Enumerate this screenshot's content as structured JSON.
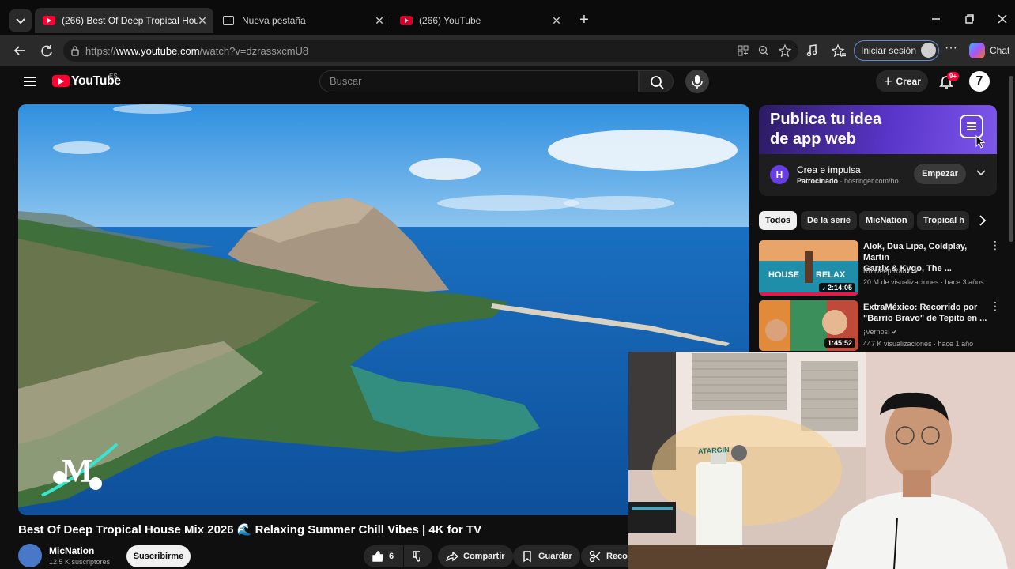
{
  "browser": {
    "tabs": [
      {
        "title": "(266) Best Of Deep Tropical House",
        "active": true
      },
      {
        "title": "Nueva pestaña",
        "active": false
      },
      {
        "title": "(266) YouTube",
        "active": false
      }
    ],
    "url_prefix": "https://",
    "url_host": "www.youtube.com",
    "url_path": "/watch?v=dzrassxcmU8",
    "signin_label": "Iniciar sesión",
    "copilot_label": "Chat"
  },
  "youtube": {
    "logo_text": "YouTube",
    "country_code": "ES",
    "search_placeholder": "Buscar",
    "create_label": "Crear",
    "notification_count": "9+",
    "avatar_letter": "7",
    "accent_color": "#ff0033"
  },
  "video": {
    "title": "Best Of Deep Tropical House Mix 2026 🌊 Relaxing Summer Chill Vibes | 4K for TV",
    "channel_name": "MicNation",
    "channel_subs": "12,5 K suscriptores",
    "subscribe_label": "Suscribirme",
    "like_count": "6",
    "share_label": "Compartir",
    "save_label": "Guardar",
    "clip_label": "Recor"
  },
  "ad": {
    "headline_line1": "Publica tu idea",
    "headline_line2": "de app web",
    "logo_letter": "H",
    "title": "Crea e impulsa",
    "sponsored_label": "Patrocinado",
    "domain": "· hostinger.com/ho...",
    "cta_label": "Empezar"
  },
  "chips": [
    "Todos",
    "De la serie",
    "MicNation",
    "Tropical h"
  ],
  "related": [
    {
      "title_line1": "Alok, Dua Lipa, Coldplay, Martin",
      "title_line2": "Garrix & Kygo, The ...",
      "channel": "Ru Deep Radio ✔",
      "meta": "20 M de visualizaciones · hace 3 años",
      "duration": "♪ 2:14:05",
      "thumb_text_left": "HOUSE",
      "thumb_text_right": "RELAX"
    },
    {
      "title_line1": "ExtraMéxico: Recorrido por",
      "title_line2": "\"Barrio Bravo\" de Tepito en ...",
      "channel": "¡Vernos! ✔",
      "meta": "447 K visualizaciones · hace 1 año",
      "duration": "1:45:52"
    }
  ],
  "webcam": {
    "bottle_label": "ATARGIN"
  }
}
